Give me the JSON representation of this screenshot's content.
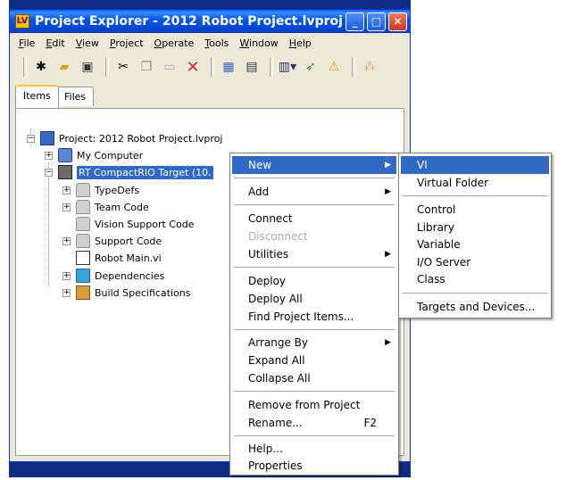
{
  "window": {
    "title": "Project Explorer - 2012 Robot Project.lvproj",
    "min_label": "_",
    "max_label": "□",
    "close_label": "✕",
    "app_icon": "LV"
  },
  "menubar": {
    "items": [
      "File",
      "Edit",
      "View",
      "Project",
      "Operate",
      "Tools",
      "Window",
      "Help"
    ]
  },
  "toolbar": {
    "icons": [
      "new-icon",
      "open-folder-icon",
      "save-all-icon",
      "cut-icon",
      "copy-icon",
      "paste-icon",
      "delete-icon",
      "project-icon",
      "build-icon",
      "view-icon",
      "deploy-icon",
      "warning-icon",
      "dependency-icon"
    ]
  },
  "tabs": {
    "items": "Items",
    "files": "Files"
  },
  "tree": {
    "project": "Project: 2012 Robot Project.lvproj",
    "my_computer": "My Computer",
    "rt_target": "RT CompactRIO Target (10.",
    "typedefs": "TypeDefs",
    "team_code": "Team Code",
    "vision_support": "Vision Support Code",
    "support_code": "Support Code",
    "robot_main": "Robot Main.vi",
    "dependencies": "Dependencies",
    "build_specs": "Build Specifications"
  },
  "context_menu": {
    "new": "New",
    "add": "Add",
    "connect": "Connect",
    "disconnect": "Disconnect",
    "utilities": "Utilities",
    "deploy": "Deploy",
    "deploy_all": "Deploy All",
    "find_project_items": "Find Project Items...",
    "arrange_by": "Arrange By",
    "expand_all": "Expand All",
    "collapse_all": "Collapse All",
    "remove_from_project": "Remove from Project",
    "rename": "Rename...",
    "rename_shortcut": "F2",
    "help": "Help...",
    "properties": "Properties"
  },
  "submenu": {
    "vi": "VI",
    "virtual_folder": "Virtual Folder",
    "control": "Control",
    "library": "Library",
    "variable": "Variable",
    "io_server": "I/O Server",
    "class": "Class",
    "targets_devices": "Targets and Devices..."
  },
  "colors": {
    "highlight": "#316ac5",
    "titlebar": "#0558e6",
    "desktop": "#0f2c84"
  }
}
